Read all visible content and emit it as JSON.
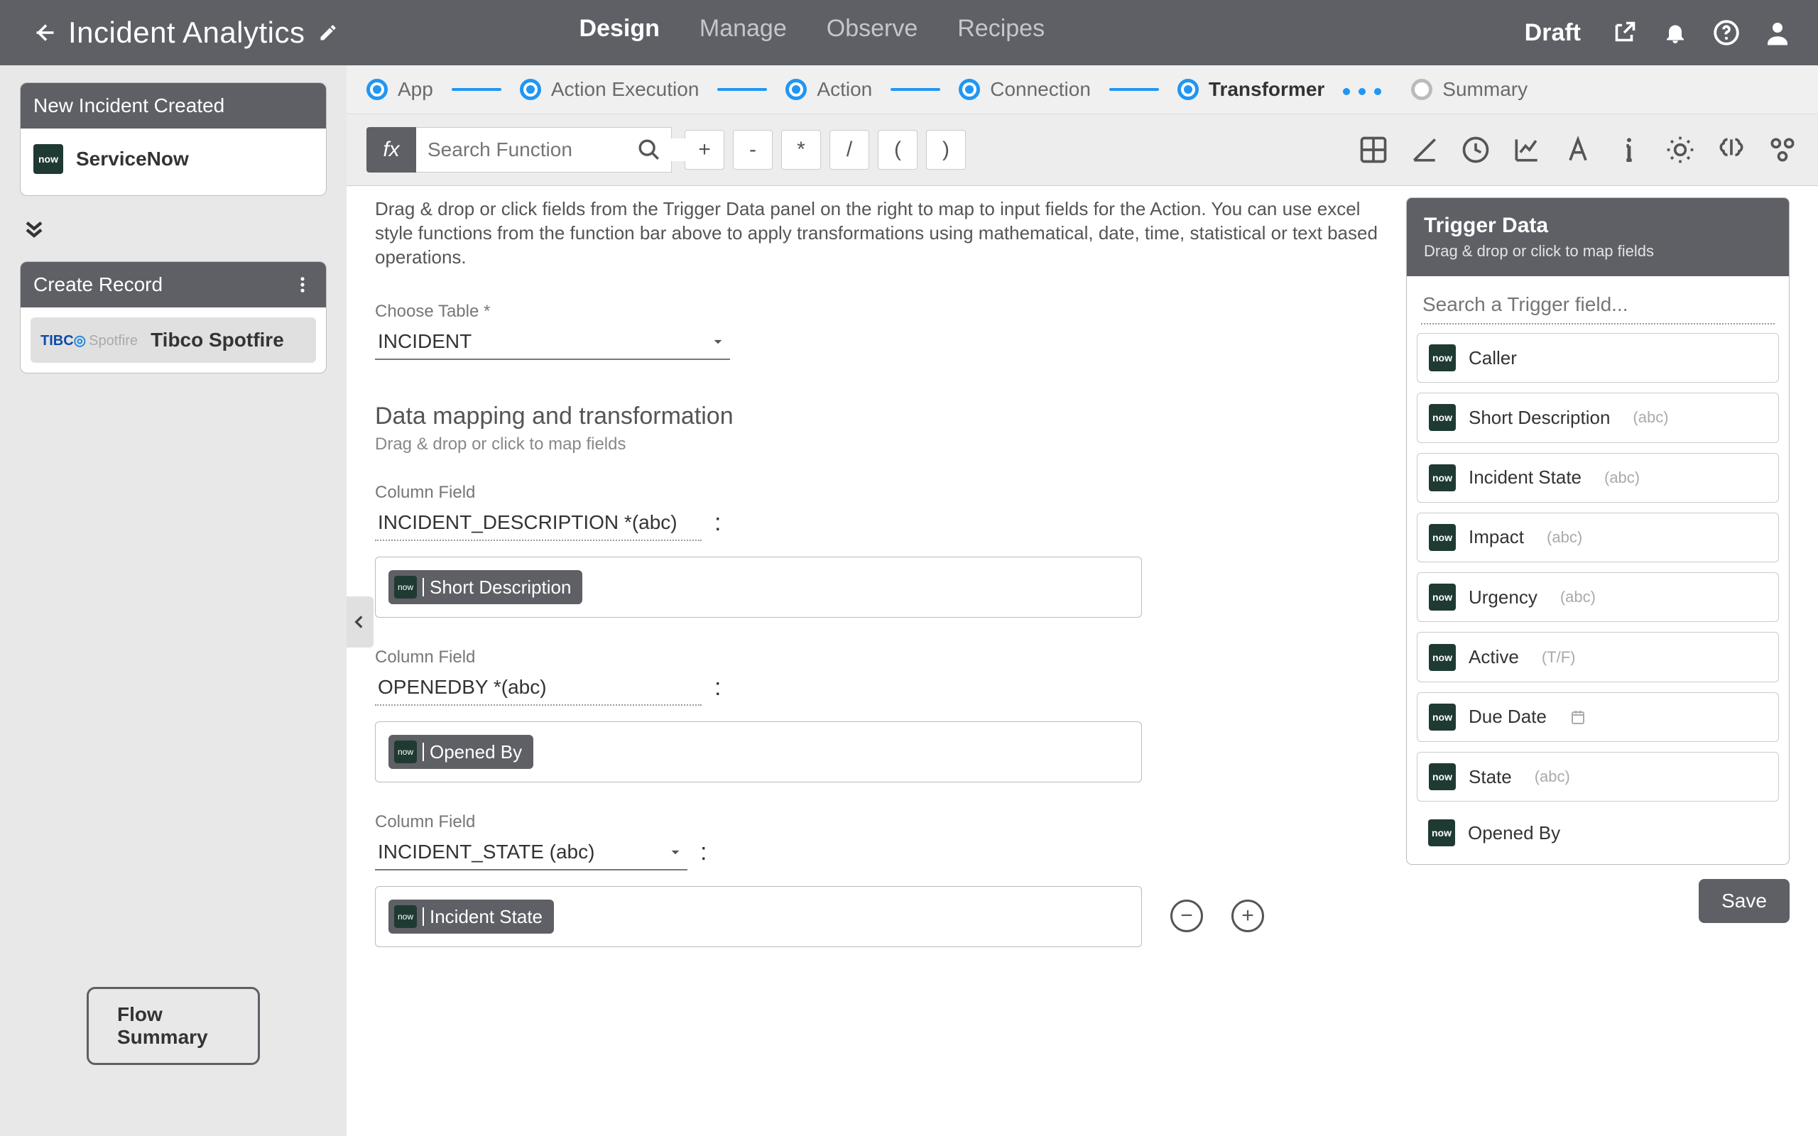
{
  "header": {
    "title": "Incident Analytics",
    "state": "Draft",
    "tabs": {
      "design": "Design",
      "manage": "Manage",
      "observe": "Observe",
      "recipes": "Recipes"
    }
  },
  "left": {
    "trigger_title": "New Incident Created",
    "trigger_app": "ServiceNow",
    "action_title": "Create Record",
    "action_app": "Tibco Spotfire",
    "summary_btn": "Flow Summary"
  },
  "steps": {
    "app": "App",
    "exec": "Action Execution",
    "action": "Action",
    "conn": "Connection",
    "trans": "Transformer",
    "summary": "Summary"
  },
  "fx": {
    "search_placeholder": "Search Function",
    "ops": [
      "+",
      "-",
      "*",
      "/",
      "(",
      ")"
    ]
  },
  "center": {
    "hint": "Drag & drop or click fields from the Trigger Data panel on the right to map to input fields for the Action. You can use excel style functions from the function bar above to apply transformations using mathematical, date, time, statistical or text based operations.",
    "choose_table_label": "Choose Table *",
    "choose_table_value": "INCIDENT",
    "section_title": "Data mapping and transformation",
    "section_sub": "Drag & drop or click to map fields",
    "col_label": "Column Field",
    "mappings": [
      {
        "field": "INCIDENT_DESCRIPTION *(abc)",
        "chip": "Short Description"
      },
      {
        "field": "OPENEDBY *(abc)",
        "chip": "Opened By"
      },
      {
        "field": "INCIDENT_STATE (abc)",
        "chip": "Incident State"
      }
    ]
  },
  "trigger": {
    "head": "Trigger Data",
    "sub": "Drag & drop or click to map fields",
    "search_placeholder": "Search a Trigger field...",
    "items": [
      {
        "name": "Caller",
        "type": ""
      },
      {
        "name": "Short Description",
        "type": "(abc)"
      },
      {
        "name": "Incident State",
        "type": "(abc)"
      },
      {
        "name": "Impact",
        "type": "(abc)"
      },
      {
        "name": "Urgency",
        "type": "(abc)"
      },
      {
        "name": "Active",
        "type": "(T/F)"
      },
      {
        "name": "Due Date",
        "type": "date"
      },
      {
        "name": "State",
        "type": "(abc)"
      },
      {
        "name": "Opened By",
        "type": ""
      }
    ],
    "save": "Save"
  }
}
